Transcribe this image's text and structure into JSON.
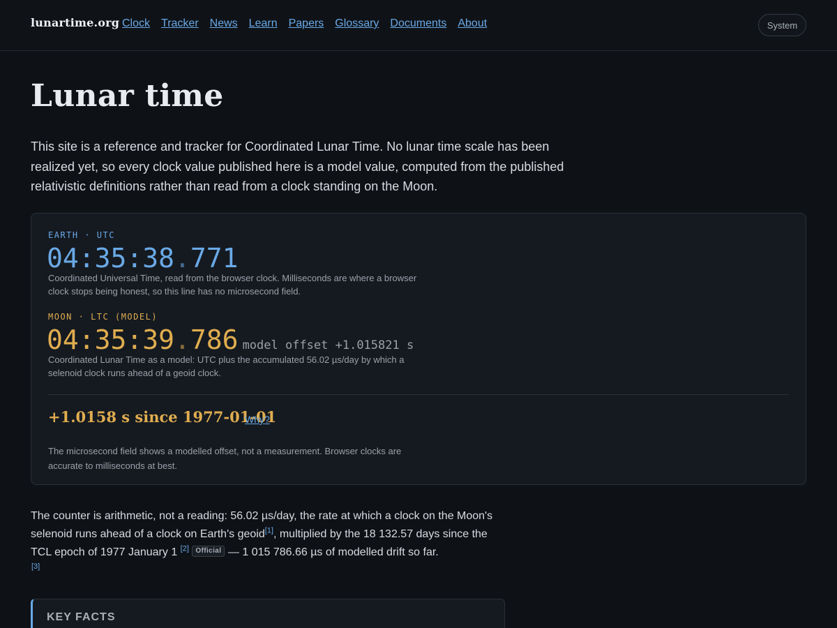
{
  "header": {
    "brand": "lunartime.org",
    "nav": [
      "Clock",
      "Tracker",
      "News",
      "Learn",
      "Papers",
      "Glossary",
      "Documents",
      "About"
    ],
    "theme_button": "System"
  },
  "page": {
    "title": "Lunar time",
    "intro": "This site is a reference and tracker for Coordinated Lunar Time. No lunar time scale has been realized yet, so every clock value published here is a model value, computed from the published relativistic definitions rather than read from a clock standing on the Moon."
  },
  "clocks": {
    "earth": {
      "label": "EARTH · UTC",
      "hms": "04:35:38",
      "sep": ".",
      "ms": "771",
      "description": "Coordinated Universal Time, read from the browser clock. Milliseconds are where a browser clock stops being honest, so this line has no microsecond field."
    },
    "moon": {
      "label": "MOON · LTC (MODEL)",
      "hms": "04:35:39",
      "sep": ".",
      "ms": "786",
      "offset": "model offset +1.015821 s",
      "description": "Coordinated Lunar Time as a model: UTC plus the accumulated 56.02 µs/day by which a selenoid clock runs ahead of a geoid clock."
    },
    "since": "+1.0158 s since 1977-01-01",
    "why_link": "Why?",
    "note": "The microsecond field shows a modelled offset, not a measurement. Browser clocks are accurate to milliseconds at best."
  },
  "explainer": {
    "part1": "The counter is arithmetic, not a reading: 56.02 µs/day, the rate at which a clock on the Moon's selenoid runs ahead of a clock on Earth's geoid",
    "ref1": "[1]",
    "part2": ", multiplied by the 18 132.57 days since the TCL epoch of 1977 January 1 ",
    "ref2": "[2]",
    "badge": "Official",
    "part3": " — 1 015 786.66 µs of modelled drift so far.",
    "ref3": "[3]"
  },
  "key_facts": {
    "title": "KEY FACTS"
  }
}
